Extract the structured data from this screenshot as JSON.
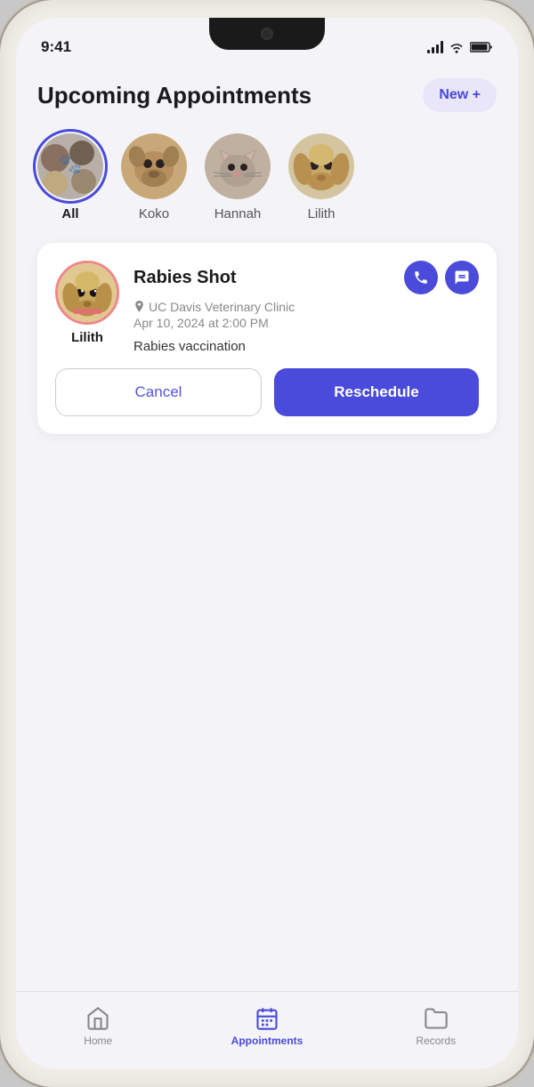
{
  "status_bar": {
    "time": "9:41"
  },
  "header": {
    "title": "Upcoming Appointments",
    "new_button_label": "New +"
  },
  "pet_filter": {
    "items": [
      {
        "id": "all",
        "label": "All",
        "active": true,
        "emoji": "🐾"
      },
      {
        "id": "koko",
        "label": "Koko",
        "active": false,
        "emoji": "🐶"
      },
      {
        "id": "hannah",
        "label": "Hannah",
        "active": false,
        "emoji": "🐱"
      },
      {
        "id": "lilith",
        "label": "Lilith",
        "active": false,
        "emoji": "🐕"
      }
    ]
  },
  "appointment": {
    "pet_name": "Lilith",
    "title": "Rabies Shot",
    "location": "UC Davis Veterinary Clinic",
    "date": "Apr 10, 2024  at  2:00 PM",
    "description": "Rabies vaccination",
    "cancel_label": "Cancel",
    "reschedule_label": "Reschedule"
  },
  "bottom_nav": {
    "items": [
      {
        "id": "home",
        "label": "Home",
        "active": false,
        "icon": "home"
      },
      {
        "id": "appointments",
        "label": "Appointments",
        "active": true,
        "icon": "calendar"
      },
      {
        "id": "records",
        "label": "Records",
        "active": false,
        "icon": "folder"
      }
    ]
  }
}
